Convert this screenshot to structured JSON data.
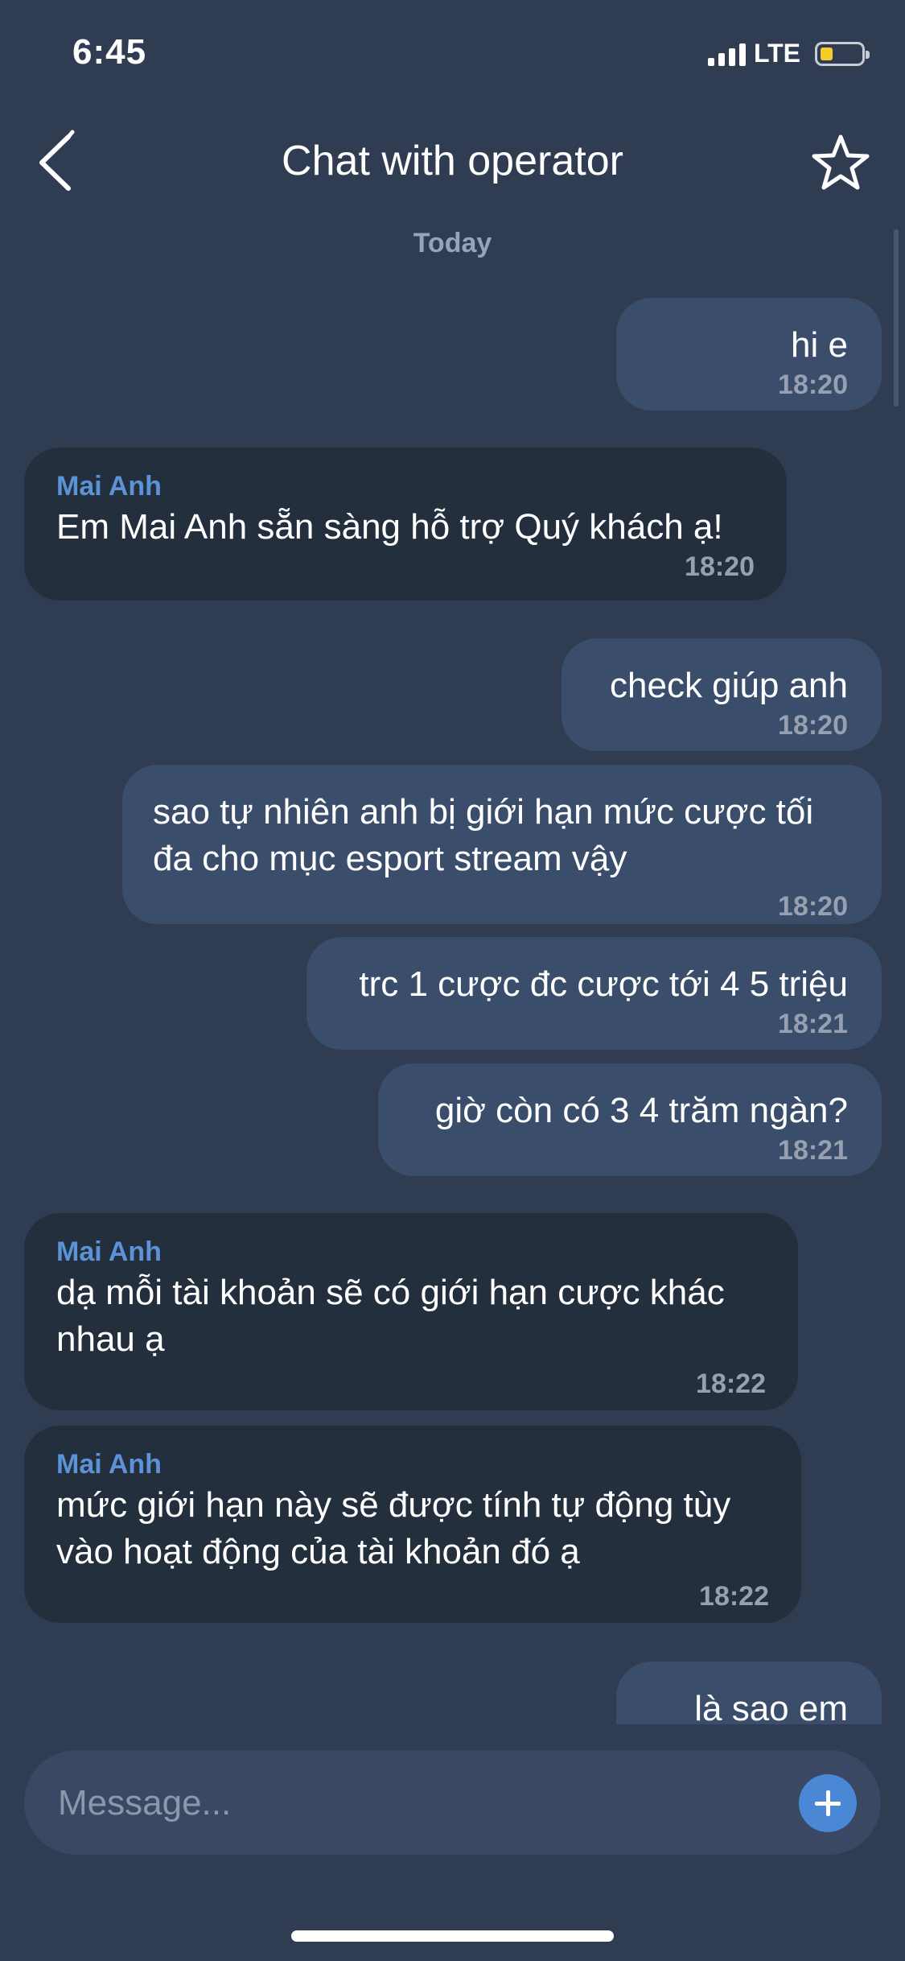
{
  "status_bar": {
    "time": "6:45",
    "network": "LTE",
    "battery_color": "#f4cd2a"
  },
  "header": {
    "title": "Chat with operator"
  },
  "chat": {
    "day_label": "Today",
    "messages": [
      {
        "direction": "out",
        "text": "hi e",
        "time": "18:20"
      },
      {
        "direction": "in",
        "sender": "Mai Anh",
        "text": "Em Mai Anh sẵn sàng hỗ trợ Quý khách ạ!",
        "time": "18:20"
      },
      {
        "direction": "out",
        "text": "check giúp anh",
        "time": "18:20"
      },
      {
        "direction": "out",
        "text": "sao tự nhiên anh bị giới hạn mức cược tối đa cho mục esport stream vậy",
        "time": "18:20"
      },
      {
        "direction": "out",
        "text": "trc 1 cược đc cược tới 4 5 triệu",
        "time": "18:21"
      },
      {
        "direction": "out",
        "text": "giờ còn có 3 4 trăm ngàn?",
        "time": "18:21"
      },
      {
        "direction": "in",
        "sender": "Mai Anh",
        "text": "dạ mỗi tài khoản sẽ có giới hạn cược khác nhau ạ",
        "time": "18:22"
      },
      {
        "direction": "in",
        "sender": "Mai Anh",
        "text": "mức giới hạn này sẽ được tính tự động tùy vào hoạt động của tài khoản đó ạ",
        "time": "18:22"
      },
      {
        "direction": "out",
        "text": "là sao em",
        "time": ""
      }
    ]
  },
  "composer": {
    "placeholder": "Message..."
  },
  "colors": {
    "background": "#2f3c52",
    "outgoing_bubble": "#3a4e6c",
    "incoming_bubble": "#242f3d",
    "sender_name": "#5b93d6",
    "accent": "#4a88d6"
  }
}
